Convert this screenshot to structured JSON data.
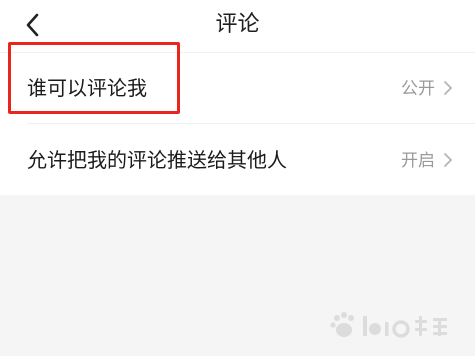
{
  "header": {
    "title": "评论",
    "back_icon": "chevron-left-icon"
  },
  "settings": {
    "items": [
      {
        "label": "谁可以评论我",
        "value": "公开"
      },
      {
        "label": "允许把我的评论推送给其他人",
        "value": "开启"
      }
    ]
  },
  "colors": {
    "highlight": "#e8261e",
    "value_text": "#9a9a9a",
    "empty_background": "#f5f5f5"
  }
}
